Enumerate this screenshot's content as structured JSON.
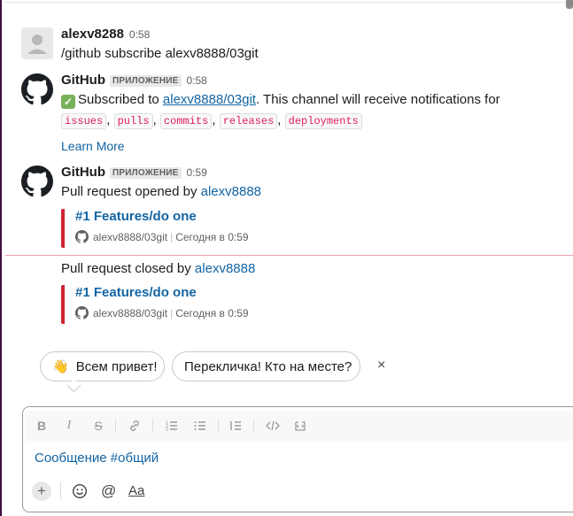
{
  "messages": [
    {
      "author": "alexv8288",
      "time": "0:58",
      "text": "/github subscribe alexv8888/03git"
    },
    {
      "author": "GitHub",
      "badge": "ПРИЛОЖЕНИЕ",
      "time": "0:58",
      "text_before": "Subscribed to ",
      "repo_link": "alexv8888/03git",
      "text_after": ". This channel will receive notifications for",
      "features": [
        "issues",
        "pulls",
        "commits",
        "releases",
        "deployments"
      ],
      "learn_more": "Learn More"
    },
    {
      "author": "GitHub",
      "badge": "ПРИЛОЖЕНИЕ",
      "time": "0:59",
      "text": "Pull request opened by ",
      "user_link": "alexv8888",
      "attachment": {
        "title": "#1 Features/do one",
        "repo": "alexv8888/03git",
        "timestamp": "Сегодня в 0:59"
      }
    },
    {
      "text": "Pull request closed by ",
      "user_link": "alexv8888",
      "attachment": {
        "title": "#1 Features/do one",
        "repo": "alexv8888/03git",
        "timestamp": "Сегодня в 0:59"
      }
    }
  ],
  "suggestions": {
    "chip1_emoji": "👋",
    "chip1": "Всем привет!",
    "chip2": "Перекличка! Кто на месте?",
    "dismiss": "×"
  },
  "composer": {
    "placeholder": "Сообщение #общий",
    "toolbar_icons": [
      "bold-icon",
      "italic-icon",
      "strikethrough-icon",
      "link-icon",
      "ordered-list-icon",
      "bulleted-list-icon",
      "blockquote-icon",
      "code-icon",
      "code-block-icon"
    ],
    "add_icon": "+",
    "format_label": "Aa"
  },
  "colors": {
    "link": "#1264a3",
    "code_text": "#e01e5a",
    "attachment_bar": "#cb2431",
    "check_green": "#78b159",
    "new_divider": "#e8a0a8"
  }
}
